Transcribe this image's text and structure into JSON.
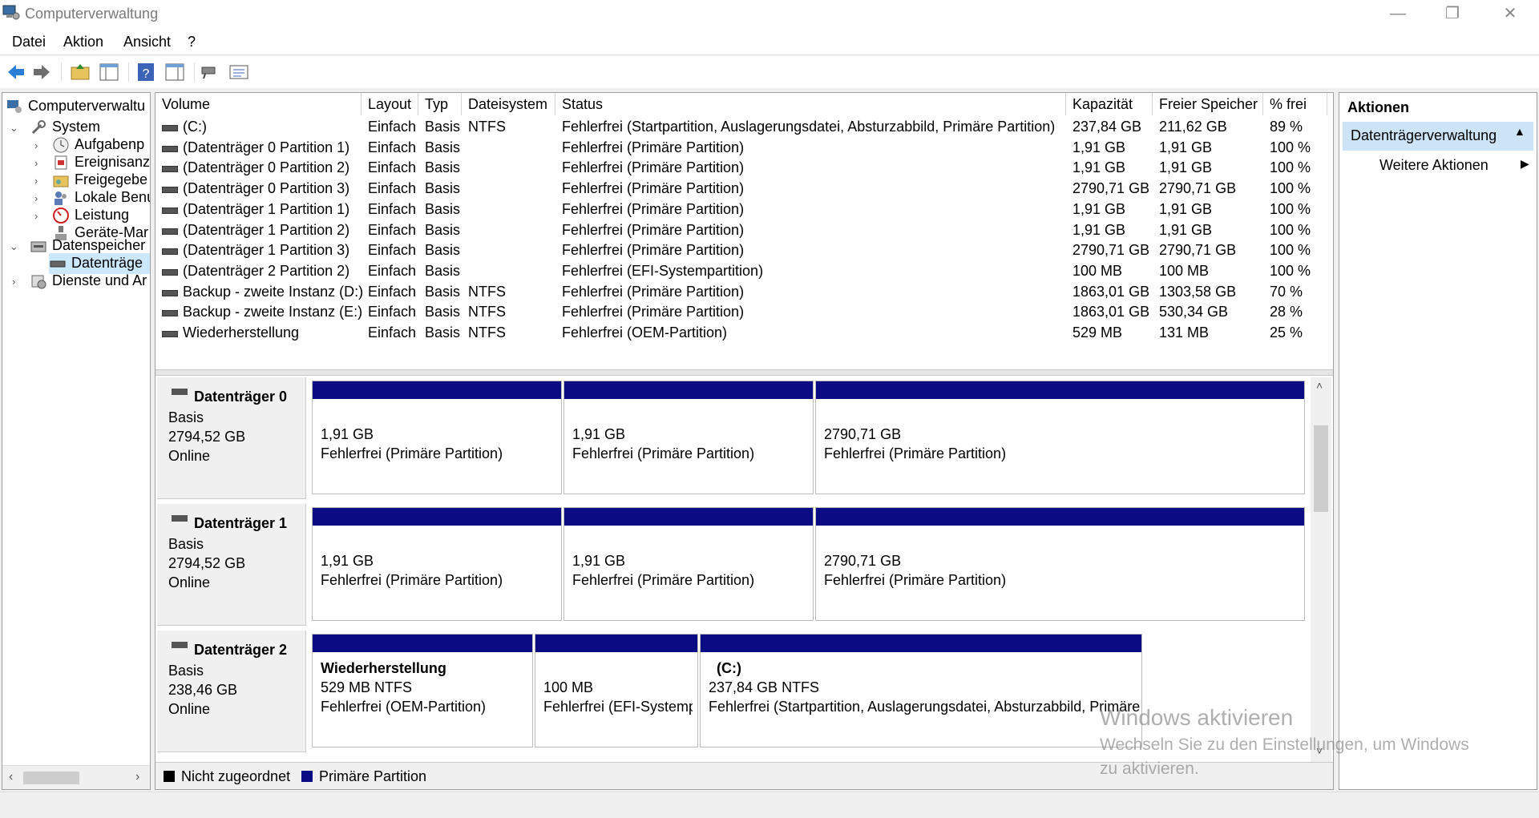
{
  "window": {
    "title": "Computerverwaltung",
    "minimize": "—",
    "restore": "❐",
    "close": "✕"
  },
  "menu": [
    "Datei",
    "Aktion",
    "Ansicht",
    "?"
  ],
  "tree": {
    "root": "Computerverwaltu",
    "system": "System",
    "items": [
      "Aufgabenp",
      "Ereignisanz",
      "Freigegebe",
      "Lokale Benu",
      "Leistung",
      "Geräte-Mar"
    ],
    "storage": "Datenspeicher",
    "storage_child": "Datenträge",
    "services": "Dienste und Ar"
  },
  "table": {
    "headers": [
      "Volume",
      "Layout",
      "Typ",
      "Dateisystem",
      "Status",
      "Kapazität",
      "Freier Speicher",
      "% frei"
    ],
    "rows": [
      [
        "(C:)",
        "Einfach",
        "Basis",
        "NTFS",
        "Fehlerfrei (Startpartition, Auslagerungsdatei, Absturzabbild, Primäre Partition)",
        "237,84 GB",
        "211,62 GB",
        "89 %"
      ],
      [
        "(Datenträger 0 Partition 1)",
        "Einfach",
        "Basis",
        "",
        "Fehlerfrei (Primäre Partition)",
        "1,91 GB",
        "1,91 GB",
        "100 %"
      ],
      [
        "(Datenträger 0 Partition 2)",
        "Einfach",
        "Basis",
        "",
        "Fehlerfrei (Primäre Partition)",
        "1,91 GB",
        "1,91 GB",
        "100 %"
      ],
      [
        "(Datenträger 0 Partition 3)",
        "Einfach",
        "Basis",
        "",
        "Fehlerfrei (Primäre Partition)",
        "2790,71 GB",
        "2790,71 GB",
        "100 %"
      ],
      [
        "(Datenträger 1 Partition 1)",
        "Einfach",
        "Basis",
        "",
        "Fehlerfrei (Primäre Partition)",
        "1,91 GB",
        "1,91 GB",
        "100 %"
      ],
      [
        "(Datenträger 1 Partition 2)",
        "Einfach",
        "Basis",
        "",
        "Fehlerfrei (Primäre Partition)",
        "1,91 GB",
        "1,91 GB",
        "100 %"
      ],
      [
        "(Datenträger 1 Partition 3)",
        "Einfach",
        "Basis",
        "",
        "Fehlerfrei (Primäre Partition)",
        "2790,71 GB",
        "2790,71 GB",
        "100 %"
      ],
      [
        "(Datenträger 2 Partition 2)",
        "Einfach",
        "Basis",
        "",
        "Fehlerfrei (EFI-Systempartition)",
        "100 MB",
        "100 MB",
        "100 %"
      ],
      [
        "Backup - zweite Instanz (D:)",
        "Einfach",
        "Basis",
        "NTFS",
        "Fehlerfrei (Primäre Partition)",
        "1863,01 GB",
        "1303,58 GB",
        "70 %"
      ],
      [
        "Backup - zweite Instanz (E:)",
        "Einfach",
        "Basis",
        "NTFS",
        "Fehlerfrei (Primäre Partition)",
        "1863,01 GB",
        "530,34 GB",
        "28 %"
      ],
      [
        "Wiederherstellung",
        "Einfach",
        "Basis",
        "NTFS",
        "Fehlerfrei (OEM-Partition)",
        "529 MB",
        "131 MB",
        "25 %"
      ]
    ]
  },
  "disks": [
    {
      "name": "Datenträger 0",
      "type": "Basis",
      "size": "2794,52 GB",
      "state": "Online",
      "parts": [
        {
          "title": "",
          "l1": "1,91 GB",
          "l2": "Fehlerfrei (Primäre Partition)"
        },
        {
          "title": "",
          "l1": "1,91 GB",
          "l2": "Fehlerfrei (Primäre Partition)"
        },
        {
          "title": "",
          "l1": "2790,71 GB",
          "l2": "Fehlerfrei (Primäre Partition)"
        }
      ]
    },
    {
      "name": "Datenträger 1",
      "type": "Basis",
      "size": "2794,52 GB",
      "state": "Online",
      "parts": [
        {
          "title": "",
          "l1": "1,91 GB",
          "l2": "Fehlerfrei (Primäre Partition)"
        },
        {
          "title": "",
          "l1": "1,91 GB",
          "l2": "Fehlerfrei (Primäre Partition)"
        },
        {
          "title": "",
          "l1": "2790,71 GB",
          "l2": "Fehlerfrei (Primäre Partition)"
        }
      ]
    },
    {
      "name": "Datenträger 2",
      "type": "Basis",
      "size": "238,46 GB",
      "state": "Online",
      "parts": [
        {
          "title": "Wiederherstellung",
          "l1": "529 MB NTFS",
          "l2": "Fehlerfrei (OEM-Partition)"
        },
        {
          "title": "",
          "l1": "100 MB",
          "l2": "Fehlerfrei (EFI-Systemp"
        },
        {
          "title": "(C:)",
          "l1": "237,84 GB NTFS",
          "l2": "Fehlerfrei (Startpartition, Auslagerungsdatei, Absturzabbild, Primäre"
        }
      ]
    }
  ],
  "legend": [
    {
      "label": "Nicht zugeordnet",
      "color": "#000000"
    },
    {
      "label": "Primäre Partition",
      "color": "#0b0b84"
    }
  ],
  "actions": {
    "header": "Aktionen",
    "selected": "Datenträgerverwaltung",
    "more": "Weitere Aktionen"
  },
  "watermark": {
    "line1": "Windows aktivieren",
    "line2": "Wechseln Sie zu den Einstellungen, um Windows",
    "line3": "zu aktivieren."
  }
}
